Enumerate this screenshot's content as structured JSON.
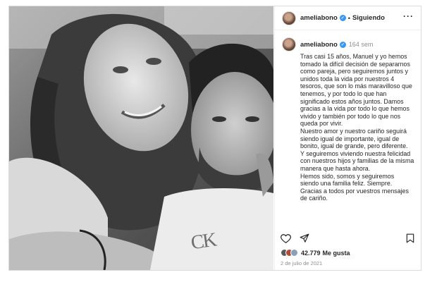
{
  "header": {
    "username": "ameliabono",
    "separator": "•",
    "follow_status": "Siguiendo",
    "more_icon": "more-horizontal-icon"
  },
  "caption": {
    "username": "ameliabono",
    "time_ago": "164 sem",
    "text": "Tras casi 15 años, Manuel y yo hemos\ntomado la difícil decisión de separarnos\ncomo pareja, pero seguiremos juntos y\nunidos toda la vida por nuestros 4\ntesoros, que son lo más maravilloso que\ntenemos, y por todo lo que han\nsignificado estos años juntos. Damos\ngracias a la vida por todo lo que hemos\nvivido y también por todo lo que nos\nqueda por vivir.\nNuestro amor y nuestro cariño seguirá\nsiendo igual de importante, igual de\nbonito, igual de grande, pero diferente.\nY seguiremos viviendo nuestra felicidad\ncon nuestros hijos y familias de la misma\nmanera que hasta ahora.\nHemos sido, somos y seguiremos\nsiendo una familia feliz. Siempre.\nGracias a todos por vuestros mensajes\nde cariño."
  },
  "actions": {
    "like_icon": "heart-icon",
    "share_icon": "send-icon",
    "save_icon": "bookmark-icon"
  },
  "likes": {
    "count": "42.779",
    "label": "Me gusta"
  },
  "date": "2 de julio de 2021",
  "photo": {
    "tshirt_text": "CK"
  },
  "colors": {
    "verified": "#3897f0",
    "muted": "#8e8e8e",
    "text": "#262626"
  }
}
